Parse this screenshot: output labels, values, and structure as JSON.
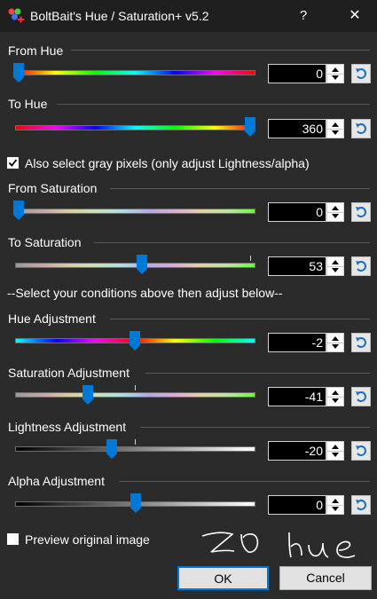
{
  "window": {
    "title": "BoltBait's Hue / Saturation+ v5.2",
    "help_label": "?",
    "close_label": "✕"
  },
  "controls": [
    {
      "id": "from-hue",
      "label": "From Hue",
      "value": "0",
      "slider_fraction": 0.0,
      "gradient": "hue"
    },
    {
      "id": "to-hue",
      "label": "To Hue",
      "value": "360",
      "slider_fraction": 1.0,
      "gradient": "hue-rev"
    },
    {
      "id": "from-saturation",
      "label": "From Saturation",
      "value": "0",
      "slider_fraction": 0.0,
      "gradient": "saturation"
    },
    {
      "id": "to-saturation",
      "label": "To Saturation",
      "value": "53",
      "slider_fraction": 0.53,
      "gradient": "saturation"
    },
    {
      "id": "hue-adjustment",
      "label": "Hue Adjustment",
      "value": "-2",
      "slider_fraction": 0.497,
      "gradient": "hue-adj"
    },
    {
      "id": "saturation-adjustment",
      "label": "Saturation Adjustment",
      "value": "-41",
      "slider_fraction": 0.295,
      "gradient": "saturation"
    },
    {
      "id": "lightness-adjustment",
      "label": "Lightness Adjustment",
      "value": "-20",
      "slider_fraction": 0.4,
      "gradient": "gray"
    },
    {
      "id": "alpha-adjustment",
      "label": "Alpha Adjustment",
      "value": "0",
      "slider_fraction": 0.5,
      "gradient": "alpha"
    }
  ],
  "gray_checkbox": {
    "label": "Also select gray pixels (only adjust Lightness/alpha)",
    "checked": true
  },
  "conditions_note": "--Select your conditions above then adjust below--",
  "preview_checkbox": {
    "label": "Preview original image",
    "checked": false
  },
  "buttons": {
    "ok": "OK",
    "cancel": "Cancel"
  },
  "colors": {
    "background": "#2b2b2b",
    "titlebar": "#1f1f1f",
    "thumb": "#0078d7",
    "accent": "#0078d7"
  },
  "icons": {
    "app": "color-wheel-plus-icon",
    "reset": "reset-arrow-icon",
    "spin": "spin-arrows-icon"
  }
}
